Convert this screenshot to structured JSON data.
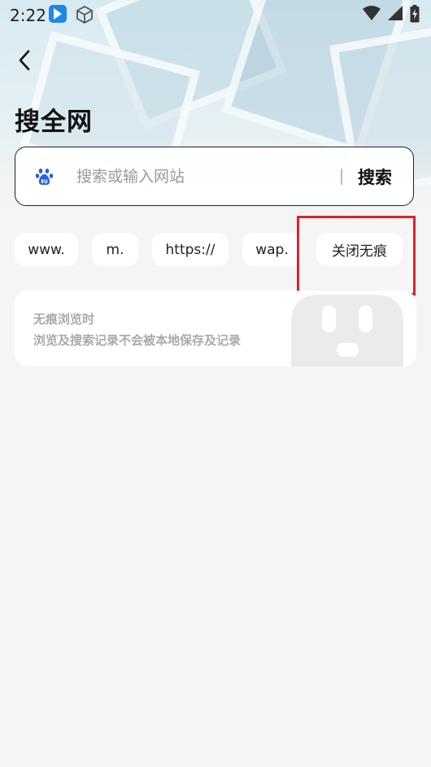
{
  "status_bar": {
    "time": "2:22"
  },
  "header": {
    "title": "搜全网"
  },
  "search": {
    "placeholder": "搜索或输入网站",
    "button_label": "搜索",
    "engine_icon": "baidu-paw-icon"
  },
  "prefix_chips": [
    {
      "label": "www."
    },
    {
      "label": "m."
    },
    {
      "label": "https://"
    },
    {
      "label": "wap."
    },
    {
      "label": "关闭无痕"
    }
  ],
  "incognito": {
    "title": "无痕浏览时",
    "description": "浏览及搜索记录不会被本地保存及记录"
  },
  "colors": {
    "background": "#f5f5f5",
    "highlight": "#e5202a",
    "baidu_blue": "#2a5fe0",
    "muted_text": "#aaaaaa"
  }
}
